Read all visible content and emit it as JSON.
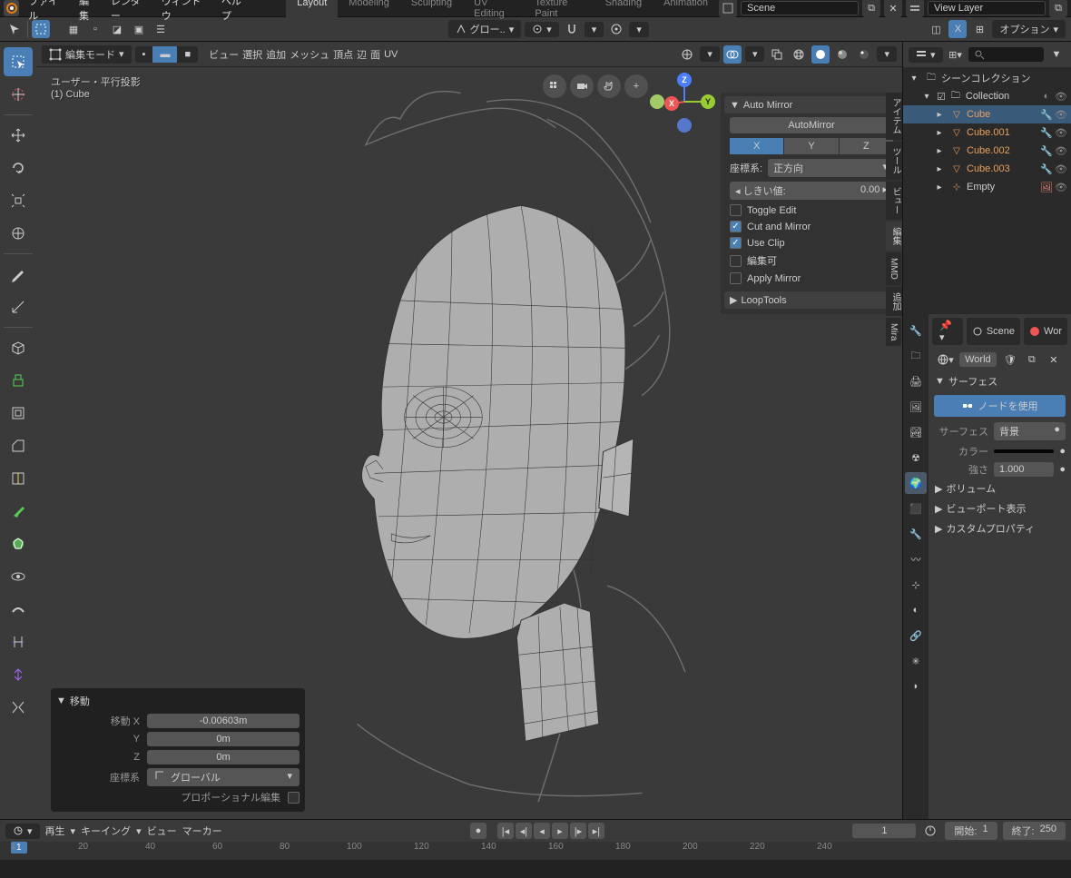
{
  "menu": {
    "file": "ファイル",
    "edit": "編集",
    "render": "レンダー",
    "window": "ウィンドウ",
    "help": "ヘルプ"
  },
  "workspaces": [
    "Layout",
    "Modeling",
    "Sculpting",
    "UV Editing",
    "Texture Paint",
    "Shading",
    "Animation"
  ],
  "workspace_active": 0,
  "scene_label": "Scene",
  "viewlayer_label": "View Layer",
  "toolrow": {
    "transform": "グロー..",
    "snap": "X",
    "options": "オプション"
  },
  "viewport": {
    "mode": "編集モード",
    "menus": {
      "view": "ビュー",
      "select": "選択",
      "add": "追加",
      "mesh": "メッシュ",
      "vertex": "頂点",
      "edge": "辺",
      "face": "面",
      "uv": "UV"
    },
    "overlay_title": "ユーザー・平行投影",
    "overlay_obj": "(1) Cube"
  },
  "npanel": {
    "title": "Auto Mirror",
    "automirror_btn": "AutoMirror",
    "axes": [
      "X",
      "Y",
      "Z"
    ],
    "axis_active": 0,
    "coord_label": "座標系:",
    "coord_val": "正方向",
    "threshold_label": "しきい値:",
    "threshold_val": "0.00",
    "toggle_edit": "Toggle Edit",
    "cut_mirror": "Cut and Mirror",
    "use_clip": "Use Clip",
    "editable": "編集可",
    "apply": "Apply Mirror",
    "looptools": "LoopTools",
    "tabs": [
      "アイテム",
      "ツール",
      "ビュー",
      "編集",
      "MMD",
      "追加",
      "Mira"
    ]
  },
  "op_panel": {
    "title": "移動",
    "move_x_lbl": "移動 X",
    "move_x": "-0.00603m",
    "y_lbl": "Y",
    "y": "0m",
    "z_lbl": "Z",
    "z": "0m",
    "orient_lbl": "座標系",
    "orient": "グローバル",
    "prop_lbl": "プロポーショナル編集"
  },
  "outliner": {
    "root": "シーンコレクション",
    "collection": "Collection",
    "items": [
      {
        "name": "Cube",
        "sel": true
      },
      {
        "name": "Cube.001"
      },
      {
        "name": "Cube.002"
      },
      {
        "name": "Cube.003"
      },
      {
        "name": "Empty",
        "type": "empty"
      }
    ]
  },
  "props": {
    "bread_scene": "Scene",
    "bread_world": "Wor",
    "world": "World",
    "surface_h": "サーフェス",
    "use_nodes": "ノードを使用",
    "surface_lbl": "サーフェス",
    "surface_val": "背景",
    "color_lbl": "カラー",
    "strength_lbl": "強さ",
    "strength_val": "1.000",
    "volume": "ボリューム",
    "viewport": "ビューポート表示",
    "custom": "カスタムプロパティ"
  },
  "timeline": {
    "play": "再生",
    "keying": "キーイング",
    "view": "ビュー",
    "marker": "マーカー",
    "frame": "1",
    "start_lbl": "開始:",
    "start": "1",
    "end_lbl": "終了:",
    "end": "250",
    "ticks": [
      1,
      20,
      40,
      60,
      80,
      100,
      120,
      140,
      160,
      180,
      200,
      220,
      240
    ]
  }
}
